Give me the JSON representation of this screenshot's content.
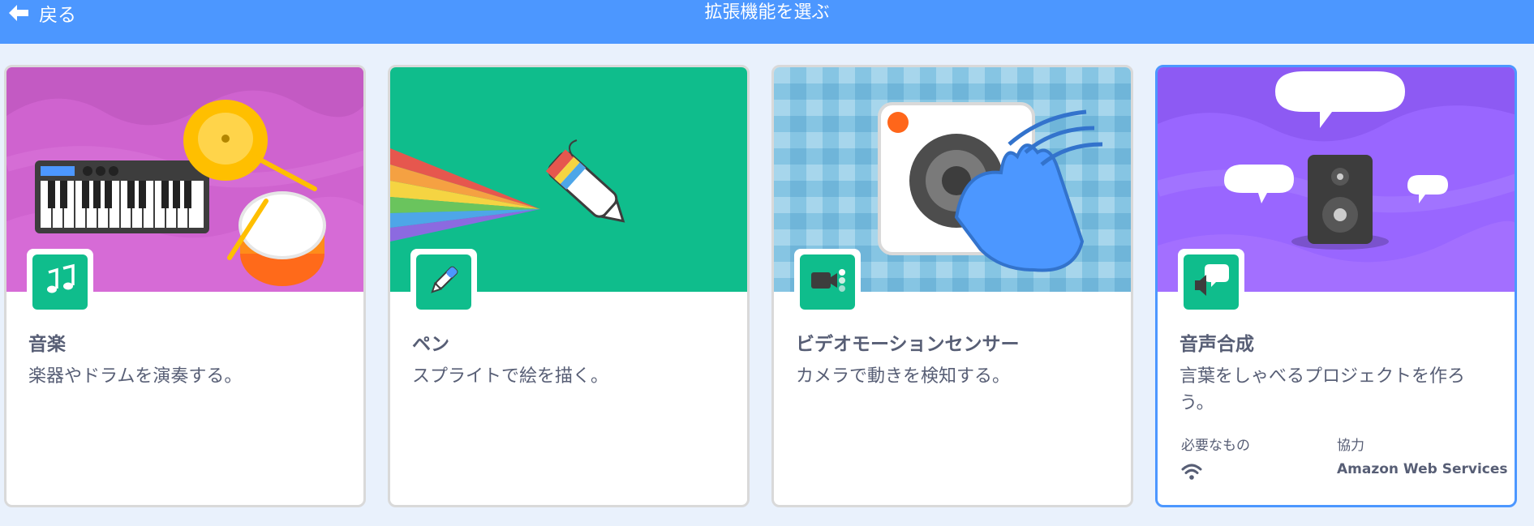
{
  "header": {
    "back_label": "戻る",
    "title": "拡張機能を選ぶ",
    "color": "#4c97ff"
  },
  "extensions": [
    {
      "name": "音楽",
      "description": "楽器やドラムを演奏する。",
      "background": "#cf63cf",
      "icon": "music-notes-icon"
    },
    {
      "name": "ペン",
      "description": "スプライトで絵を描く。",
      "background": "#0fbd8c",
      "icon": "pen-icon"
    },
    {
      "name": "ビデオモーションセンサー",
      "description": "カメラで動きを検知する。",
      "background": "#7fc1e0",
      "icon": "video-camera-icon"
    },
    {
      "name": "音声合成",
      "description": "言葉をしゃべるプロジェクトを作ろう。",
      "background": "#9966ff",
      "icon": "speech-bubble-icon",
      "requirements_label": "必要なもの",
      "requirements_icon": "wifi-icon",
      "collaborator_label": "協力",
      "collaborator": "Amazon Web Services"
    }
  ]
}
